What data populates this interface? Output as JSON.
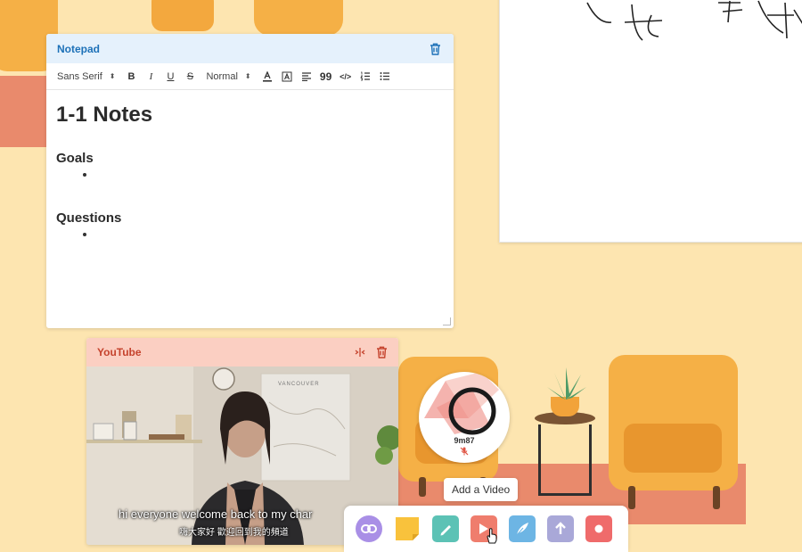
{
  "notepad": {
    "title": "Notepad",
    "toolbar": {
      "font": "Sans Serif",
      "size": "Normal",
      "bold": "B",
      "italic": "I",
      "underline": "U",
      "strike": "S",
      "quote": "99",
      "code": "</>"
    },
    "content": {
      "heading": "1-1 Notes",
      "section1": "Goals",
      "section2": "Questions"
    }
  },
  "youtube": {
    "title": "YouTube",
    "caption_en": "hi everyone welcome back to my char",
    "caption_zh": "嗨大家好 歡迎回到我的頻道",
    "poster_text": "VANCOUVER"
  },
  "participant": {
    "name": "9m87"
  },
  "tooltip": "Add a Video",
  "dock": {
    "buttons": [
      "link",
      "sticky-note",
      "pencil",
      "video",
      "pen",
      "upload",
      "record"
    ]
  },
  "colors": {
    "background": "#fde5b0",
    "notepad_header": "#e5f1fc",
    "notepad_accent": "#1d71b8",
    "youtube_header": "#fbcfc2",
    "youtube_accent": "#c5432d",
    "link_btn": "#a98fe6",
    "sticky_btn": "#f9c23c",
    "pencil_btn": "#5cc2b5",
    "video_btn": "#ef7d6d",
    "pen_btn": "#6db5e4",
    "upload_btn": "#a9a8d8",
    "record_btn": "#ef6b6b"
  }
}
